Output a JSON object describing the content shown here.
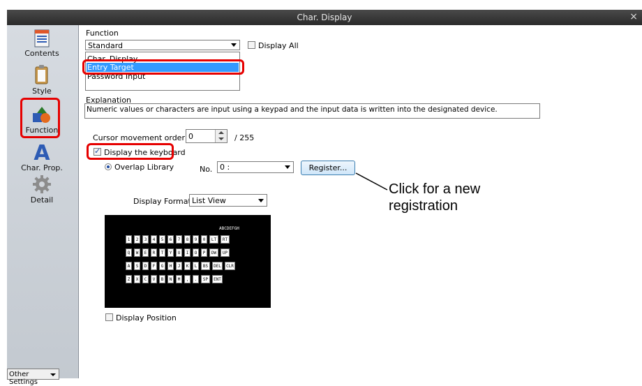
{
  "window": {
    "title": "Char. Display",
    "close_glyph": "×"
  },
  "sidebar": {
    "items": [
      {
        "label": "Contents",
        "icon": "contents-icon"
      },
      {
        "label": "Style",
        "icon": "clipboard-icon"
      },
      {
        "label": "Function",
        "icon": "shapes-icon"
      },
      {
        "label": "Char. Prop.",
        "icon": "letter-a-icon"
      },
      {
        "label": "Detail",
        "icon": "gear-icon"
      }
    ],
    "other_settings": "Other Settings"
  },
  "function_section": {
    "label": "Function",
    "select_value": "Standard",
    "display_all_label": "Display All",
    "list_items": [
      "Char. Display",
      "Entry Target",
      "Password Input"
    ],
    "selected_index": 1
  },
  "explanation": {
    "label": "Explanation",
    "text": "Numeric values or characters are input using a keypad and the input data is written into the designated device."
  },
  "cursor": {
    "label": "Cursor movement order",
    "value": "0",
    "max": "/ 255"
  },
  "keyboard": {
    "display_label": "Display the keyboard",
    "overlap_label": "Overlap Library",
    "no_label": "No.",
    "no_value": "0 :",
    "register_label": "Register...",
    "display_format_label": "Display Format",
    "display_format_value": "List View",
    "preview_header": "ABCDEFGH",
    "rows": [
      [
        "1",
        "2",
        "3",
        "4",
        "5",
        "6",
        "7",
        "8",
        "9",
        "0",
        "LT",
        "RT"
      ],
      [
        "Q",
        "W",
        "E",
        "R",
        "T",
        "Y",
        "U",
        "I",
        "O",
        "P",
        "DW",
        "UP"
      ],
      [
        "A",
        "S",
        "D",
        "F",
        "G",
        "H",
        "J",
        "K",
        "L",
        "BS",
        "DEL",
        "CLR"
      ],
      [
        "Z",
        "X",
        "C",
        "V",
        "B",
        "N",
        "M",
        ",",
        ".",
        "SP",
        "ENT"
      ]
    ],
    "display_position_label": "Display Position"
  },
  "annotation": {
    "line1": "Click for a new",
    "line2": "registration"
  },
  "colors": {
    "highlight": "#e60000",
    "selection": "#3399ff",
    "accent": "#1e4aa0"
  }
}
